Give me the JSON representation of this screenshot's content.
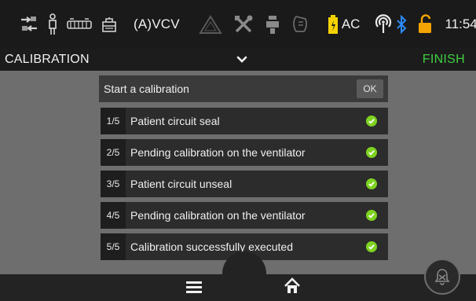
{
  "status_bar": {
    "mode": "(A)VCV",
    "power_source": "AC",
    "time": "11:54",
    "icons": {
      "left": [
        "ventilation-flow-icon",
        "patient-icon",
        "circuit-icon",
        "humidifier-icon"
      ],
      "middle": [
        "alarm-triangle-icon",
        "tools-icon",
        "filter-icon",
        "mask-icon"
      ],
      "right": [
        "battery-icon",
        "wireless-icon",
        "bluetooth-icon",
        "lock-icon"
      ]
    },
    "colors": {
      "battery": "#f5d300",
      "bluetooth": "#2b8cff",
      "lock": "#f3a400"
    }
  },
  "title_bar": {
    "title": "CALIBRATION",
    "action": "FINISH",
    "action_color": "#3fcf3f"
  },
  "calibration": {
    "start_label": "Start a calibration",
    "ok_label": "OK",
    "steps": [
      {
        "number": "1/5",
        "label": "Patient circuit seal",
        "done": true
      },
      {
        "number": "2/5",
        "label": "Pending calibration on the ventilator",
        "done": true
      },
      {
        "number": "3/5",
        "label": "Patient circuit unseal",
        "done": true
      },
      {
        "number": "4/5",
        "label": "Pending calibration on the ventilator",
        "done": true
      },
      {
        "number": "5/5",
        "label": "Calibration successfully executed",
        "done": true
      }
    ],
    "check_color": "#7ed321"
  },
  "bottom_bar": {
    "buttons": [
      "menu-icon",
      "home-icon",
      "alarm-silence-icon"
    ]
  }
}
